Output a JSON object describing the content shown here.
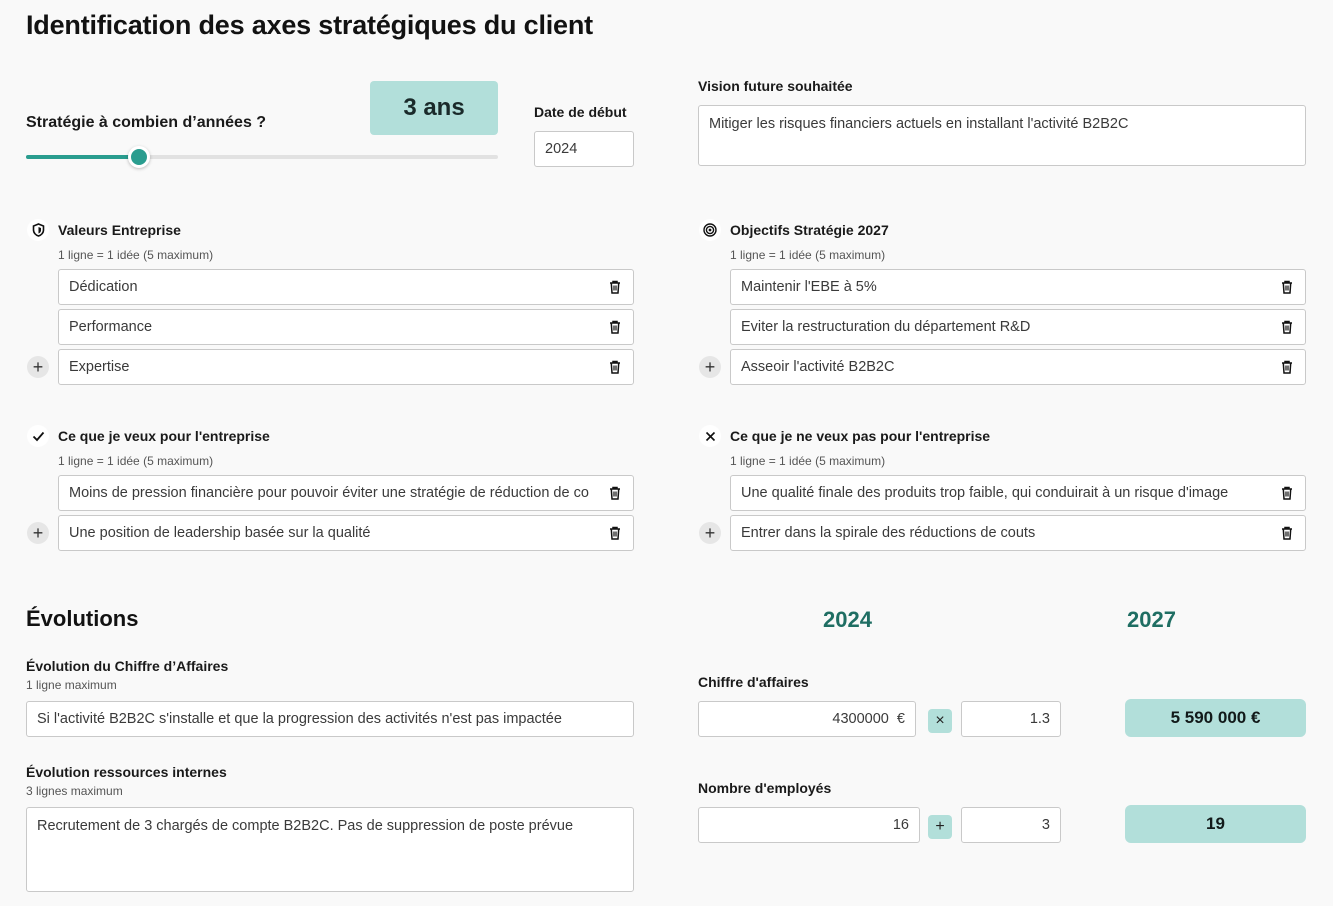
{
  "page_title": "Identification des axes stratégiques du client",
  "strategy": {
    "years_label": "Stratégie à combien d’années ?",
    "years_badge": "3 ans",
    "slider_fraction": 0.24,
    "start_date_label": "Date de début",
    "start_date_value": "2024"
  },
  "vision": {
    "label": "Vision future souhaitée",
    "value": "Mitiger les risques financiers actuels en installant l'activité B2B2C"
  },
  "values": {
    "title": "Valeurs Entreprise",
    "hint": "1 ligne = 1 idée (5 maximum)",
    "icon": "shield-icon",
    "items": [
      "Dédication",
      "Performance",
      "Expertise"
    ]
  },
  "objectives": {
    "title": "Objectifs Stratégie 2027",
    "hint": "1 ligne = 1 idée (5 maximum)",
    "icon": "target-icon",
    "items": [
      "Maintenir l'EBE à 5%",
      "Eviter la restructuration du département R&D",
      "Asseoir l'activité B2B2C"
    ]
  },
  "wants": {
    "title": "Ce que je veux pour l'entreprise",
    "hint": "1 ligne = 1 idée (5 maximum)",
    "icon": "check-icon",
    "items": [
      "Moins de pression financière pour pouvoir éviter une stratégie de réduction de co",
      "Une position de leadership basée sur la qualité"
    ]
  },
  "not_wants": {
    "title": "Ce que je ne veux pas pour l'entreprise",
    "hint": "1 ligne = 1 idée (5 maximum)",
    "icon": "x-icon",
    "items": [
      "Une qualité finale des produits trop faible, qui conduirait à un risque d'image",
      "Entrer dans la spirale des réductions de couts"
    ]
  },
  "evolutions": {
    "title": "Évolutions",
    "year_start": "2024",
    "year_end": "2027",
    "revenue_evolution": {
      "label": "Évolution du Chiffre d’Affaires",
      "hint": "1 ligne maximum",
      "value": "Si l'activité B2B2C s'installe et que la progression des activités n'est pas impactée"
    },
    "resources_evolution": {
      "label": "Évolution ressources internes",
      "hint": "3 lignes maximum",
      "value": "Recrutement de 3 chargés de compte B2B2C. Pas de suppression de poste prévue"
    },
    "revenue": {
      "label": "Chiffre d'affaires",
      "base": "4300000  €",
      "operator": "×",
      "factor": "1.3",
      "result": "5 590 000 €"
    },
    "employees": {
      "label": "Nombre d'employés",
      "base": "16",
      "operator": "+",
      "delta": "3",
      "result": "19"
    }
  },
  "colors": {
    "accent": "#2a9d8f",
    "accent_light": "#b2dfda",
    "year_heading": "#1f6e63"
  }
}
